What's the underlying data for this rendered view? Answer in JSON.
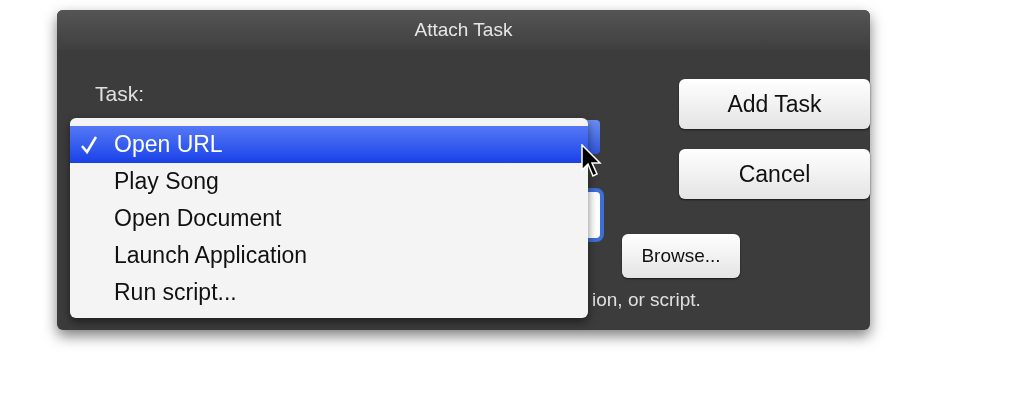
{
  "window": {
    "title": "Attach Task"
  },
  "task": {
    "label": "Task:"
  },
  "menu": {
    "items": [
      {
        "label": "Open URL",
        "selected": true
      },
      {
        "label": "Play Song",
        "selected": false
      },
      {
        "label": "Open Document",
        "selected": false
      },
      {
        "label": "Launch Application",
        "selected": false
      },
      {
        "label": "Run script...",
        "selected": false
      }
    ]
  },
  "url": {
    "hint": "ion, or script."
  },
  "browse_button": "Browse...",
  "buttons": [
    "Add Task",
    "Cancel"
  ]
}
